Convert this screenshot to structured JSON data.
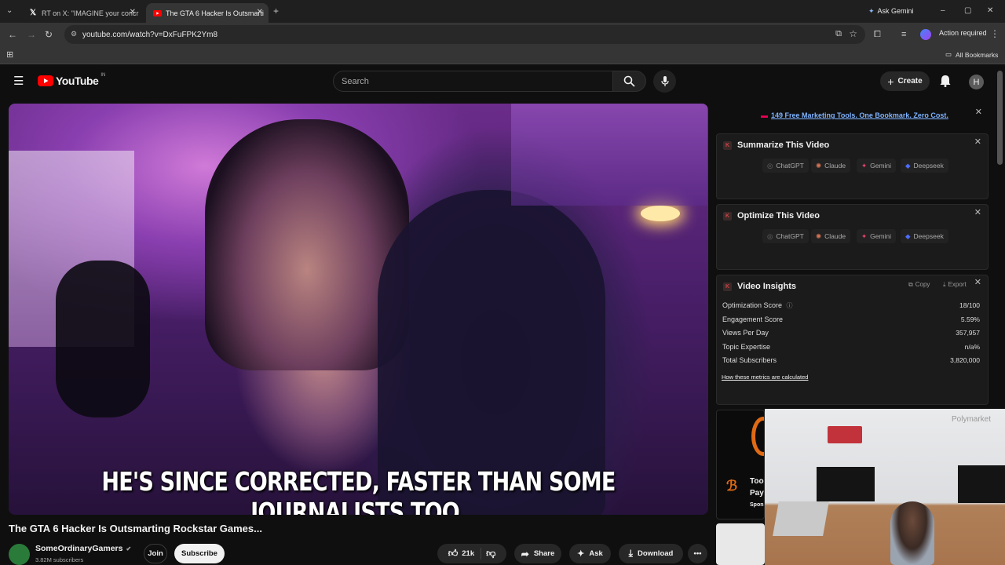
{
  "browser": {
    "tabs": [
      {
        "title": "RT on X: \"IMAGINE your concr",
        "icon": "x-logo-icon"
      },
      {
        "title": "The GTA 6 Hacker Is Outsmarti",
        "icon": "youtube-favicon-icon"
      }
    ],
    "ask_gemini": "Ask Gemini",
    "url": "youtube.com/watch?v=DxFuFPK2Ym8",
    "action_required": "Action required",
    "all_bookmarks": "All Bookmarks"
  },
  "youtube": {
    "logo_text": "YouTube",
    "country_code": "IN",
    "search_placeholder": "Search",
    "create_label": "Create",
    "avatar_letter": "H"
  },
  "video": {
    "caption": "HE'S SINCE CORRECTED, FASTER THAN SOME JOURNALISTS TOO.",
    "title": "The GTA 6 Hacker Is Outsmarting Rockstar Games...",
    "channel": "SomeOrdinaryGamers",
    "subscribers": "3.82M subscribers",
    "join": "Join",
    "subscribe": "Subscribe",
    "likes": "21k",
    "share": "Share",
    "ask": "Ask",
    "download": "Download"
  },
  "extension": {
    "promo": "149 Free Marketing Tools. One Bookmark. Zero Cost.",
    "summarize_title": "Summarize This Video",
    "optimize_title": "Optimize This Video",
    "ai_buttons": [
      "ChatGPT",
      "Claude",
      "Gemini",
      "Deepseek"
    ],
    "insights_title": "Video Insights",
    "copy": "Copy",
    "export": "Export",
    "metrics": [
      {
        "label": "Optimization Score",
        "value": "18/100"
      },
      {
        "label": "Engagement Score",
        "value": "5.59%"
      },
      {
        "label": "Views Per Day",
        "value": "357,957"
      },
      {
        "label": "Topic Expertise",
        "value": "n/a%"
      },
      {
        "label": "Total Subscribers",
        "value": "3,820,000"
      }
    ],
    "metrics_link": "How these metrics are calculated"
  },
  "ad": {
    "text1": "Too",
    "text2": "Pay",
    "text3": "Spon",
    "overlay_brand": "Polymarket"
  }
}
